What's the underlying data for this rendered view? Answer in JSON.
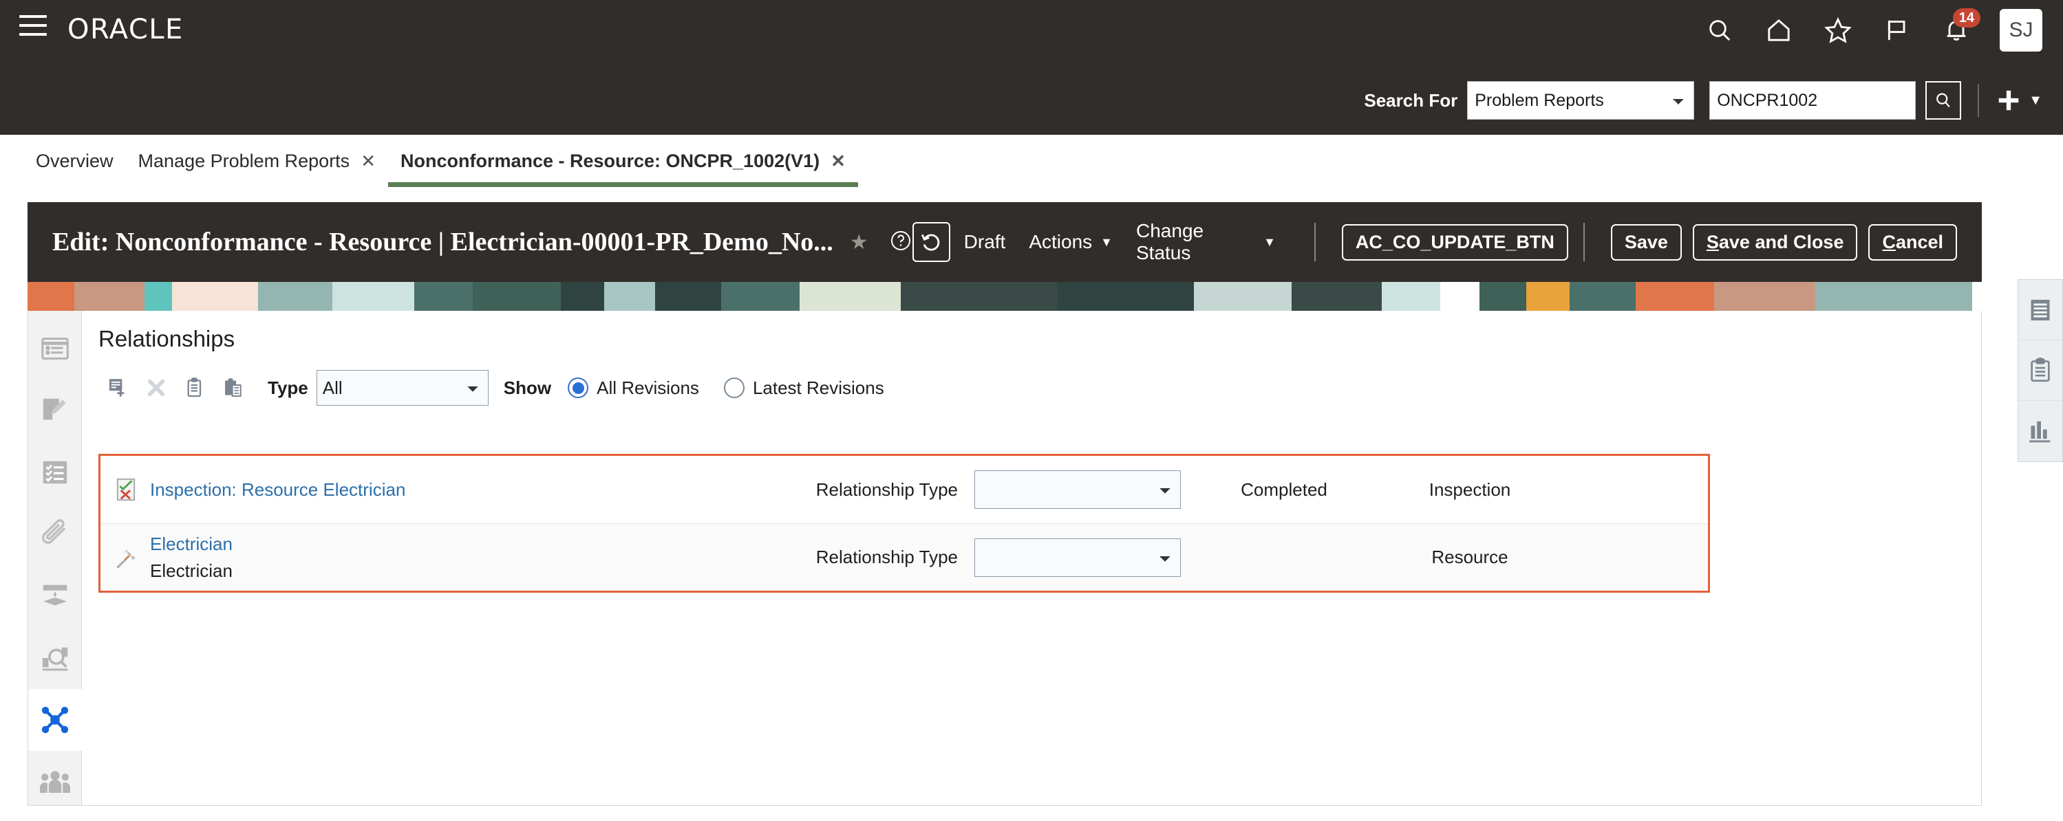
{
  "header": {
    "brand": "ORACLE",
    "menu_icon": "hamburger-icon",
    "icons": [
      {
        "name": "search-icon",
        "label": "Search"
      },
      {
        "name": "home-icon",
        "label": "Home"
      },
      {
        "name": "star-icon",
        "label": "Favorites"
      },
      {
        "name": "flag-icon",
        "label": "Flags"
      },
      {
        "name": "bell-icon",
        "label": "Notifications",
        "badge": "14"
      }
    ],
    "avatar_initials": "SJ",
    "search": {
      "label": "Search For",
      "category_selected": "Problem Reports",
      "category_options": [
        "Problem Reports"
      ],
      "query_value": "ONCPR1002",
      "query_placeholder": "",
      "go_icon": "search-icon",
      "plus_icon": "plus-icon"
    }
  },
  "tabs": [
    {
      "label": "Overview",
      "active": false,
      "closable": false
    },
    {
      "label": "Manage Problem Reports",
      "active": false,
      "closable": true
    },
    {
      "label": "Nonconformance - Resource: ONCPR_1002(V1)",
      "active": true,
      "closable": true
    }
  ],
  "record_header": {
    "title": "Edit: Nonconformance - Resource | Electrician-00001-PR_Demo_No...",
    "star_icon": "star-filled-icon",
    "help_icon": "help-circle-icon",
    "revert_icon": "revert-icon",
    "status": "Draft",
    "actions_menu": "Actions",
    "change_status_menu": "Change Status",
    "buttons": [
      {
        "label": "AC_CO_UPDATE_BTN",
        "accesskey": ""
      },
      {
        "label": "Save",
        "accesskey": ""
      },
      {
        "label": "Save and Close",
        "accesskey": "S"
      },
      {
        "label": "Cancel",
        "accesskey": "C"
      }
    ]
  },
  "banner_colors": [
    "#E0764A",
    "#C89882",
    "#5FC4BE",
    "#F7E3D8",
    "#95B5B0",
    "#CDE3E0",
    "#4A7069",
    "#2F4440",
    "#A8C7C4",
    "#DCE4D4",
    "#3A4A47",
    "#C6D6D2",
    "#E8A23C",
    "#E0764A",
    "#C89882"
  ],
  "left_rail": [
    {
      "name": "sidebar-item-summary",
      "icon": "summary-card-icon",
      "active": false
    },
    {
      "name": "sidebar-item-edit",
      "icon": "document-edit-icon",
      "active": false
    },
    {
      "name": "sidebar-item-checklist",
      "icon": "checklist-icon",
      "active": false
    },
    {
      "name": "sidebar-item-attachments",
      "icon": "paperclip-icon",
      "active": false
    },
    {
      "name": "sidebar-item-workflow",
      "icon": "workflow-icon",
      "active": false
    },
    {
      "name": "sidebar-item-analysis",
      "icon": "analysis-search-icon",
      "active": false
    },
    {
      "name": "sidebar-item-relationships",
      "icon": "network-nodes-icon",
      "active": true
    },
    {
      "name": "sidebar-item-team",
      "icon": "people-group-icon",
      "active": false
    }
  ],
  "right_rail": [
    {
      "name": "rightrail-item-details",
      "icon": "lines-document-icon"
    },
    {
      "name": "rightrail-item-clipboard",
      "icon": "clipboard-icon"
    },
    {
      "name": "rightrail-item-reports",
      "icon": "bar-chart-icon"
    }
  ],
  "panel": {
    "title": "Relationships",
    "toolbar": {
      "add_icon": "add-document-icon",
      "delete_icon": "remove-x-icon",
      "copy_icon": "copy-clipboard-icon",
      "paste_icon": "paste-clipboard-icon",
      "type_label": "Type",
      "type_selected": "All",
      "type_options": [
        "All"
      ],
      "show_label": "Show",
      "radio_all": "All Revisions",
      "radio_latest": "Latest Revisions",
      "radio_selected": "All Revisions"
    },
    "relationship_type_label": "Relationship Type",
    "highlight_color": "#E3603A",
    "rows": [
      {
        "icon": "inspection-check-x-icon",
        "link": "Inspection: Resource Electrician",
        "sub": "",
        "relationship_type_label": "Relationship Type",
        "relationship_type_value": "",
        "status": "Completed",
        "object_type": "Inspection"
      },
      {
        "icon": "tools-wrench-icon",
        "link": "Electrician",
        "sub": "Electrician",
        "relationship_type_label": "Relationship Type",
        "relationship_type_value": "",
        "status": "",
        "object_type": "Resource"
      }
    ]
  }
}
